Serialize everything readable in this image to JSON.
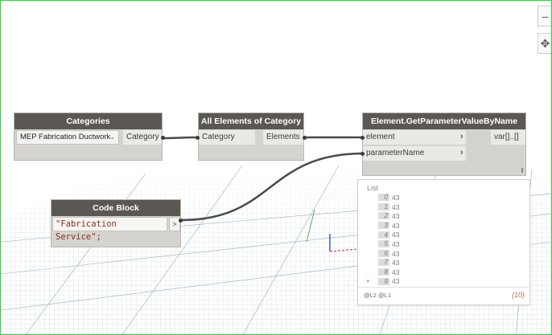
{
  "nodes": {
    "categories": {
      "title": "Categories",
      "dropdown_value": "MEP Fabrication Ductwork",
      "output": "Category"
    },
    "all_elements": {
      "title": "All Elements of Category",
      "input": "Category",
      "output": "Elements"
    },
    "get_param": {
      "title": "Element.GetParameterValueByName",
      "input_element": "element",
      "input_param": "parameterName",
      "output": "var[]..[]"
    },
    "code_block": {
      "title": "Code Block",
      "code": "\"Fabrication Service\";",
      "output_arrow": ">"
    }
  },
  "preview": {
    "list_label": "List",
    "items": [
      {
        "index": "0",
        "value": "43"
      },
      {
        "index": "1",
        "value": "43"
      },
      {
        "index": "2",
        "value": "43"
      },
      {
        "index": "3",
        "value": "43"
      },
      {
        "index": "4",
        "value": "43"
      },
      {
        "index": "5",
        "value": "43"
      },
      {
        "index": "6",
        "value": "43"
      },
      {
        "index": "7",
        "value": "43"
      },
      {
        "index": "8",
        "value": "43"
      },
      {
        "index": "9",
        "value": "43"
      }
    ],
    "levels": "@L2 @L1",
    "count": "{10}"
  },
  "nav": {
    "zoom_out_icon": "minus-icon",
    "pan_icon": "move-icon"
  },
  "colors": {
    "node_header": "#5b5753",
    "node_body": "#d5d3cf",
    "wire": "#4a4a4a",
    "canvas_border": "#2fd23a",
    "grid": "#7fa6b8"
  }
}
